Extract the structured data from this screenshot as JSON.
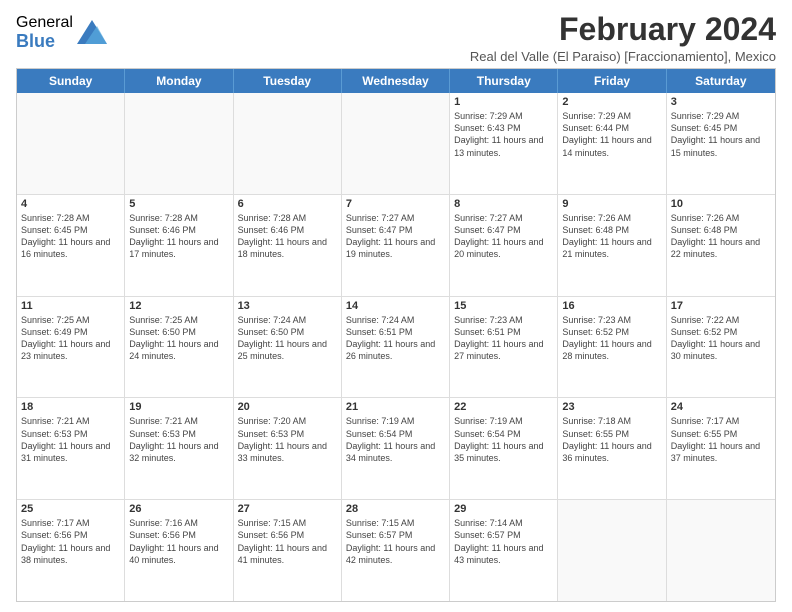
{
  "header": {
    "logo": {
      "general": "General",
      "blue": "Blue"
    },
    "title": "February 2024",
    "subtitle": "Real del Valle (El Paraiso) [Fraccionamiento], Mexico"
  },
  "calendar": {
    "days_of_week": [
      "Sunday",
      "Monday",
      "Tuesday",
      "Wednesday",
      "Thursday",
      "Friday",
      "Saturday"
    ],
    "weeks": [
      [
        {
          "day": "",
          "empty": true
        },
        {
          "day": "",
          "empty": true
        },
        {
          "day": "",
          "empty": true
        },
        {
          "day": "",
          "empty": true
        },
        {
          "day": "1",
          "sunrise": "7:29 AM",
          "sunset": "6:43 PM",
          "daylight": "11 hours and 13 minutes."
        },
        {
          "day": "2",
          "sunrise": "7:29 AM",
          "sunset": "6:44 PM",
          "daylight": "11 hours and 14 minutes."
        },
        {
          "day": "3",
          "sunrise": "7:29 AM",
          "sunset": "6:45 PM",
          "daylight": "11 hours and 15 minutes."
        }
      ],
      [
        {
          "day": "4",
          "sunrise": "7:28 AM",
          "sunset": "6:45 PM",
          "daylight": "11 hours and 16 minutes."
        },
        {
          "day": "5",
          "sunrise": "7:28 AM",
          "sunset": "6:46 PM",
          "daylight": "11 hours and 17 minutes."
        },
        {
          "day": "6",
          "sunrise": "7:28 AM",
          "sunset": "6:46 PM",
          "daylight": "11 hours and 18 minutes."
        },
        {
          "day": "7",
          "sunrise": "7:27 AM",
          "sunset": "6:47 PM",
          "daylight": "11 hours and 19 minutes."
        },
        {
          "day": "8",
          "sunrise": "7:27 AM",
          "sunset": "6:47 PM",
          "daylight": "11 hours and 20 minutes."
        },
        {
          "day": "9",
          "sunrise": "7:26 AM",
          "sunset": "6:48 PM",
          "daylight": "11 hours and 21 minutes."
        },
        {
          "day": "10",
          "sunrise": "7:26 AM",
          "sunset": "6:48 PM",
          "daylight": "11 hours and 22 minutes."
        }
      ],
      [
        {
          "day": "11",
          "sunrise": "7:25 AM",
          "sunset": "6:49 PM",
          "daylight": "11 hours and 23 minutes."
        },
        {
          "day": "12",
          "sunrise": "7:25 AM",
          "sunset": "6:50 PM",
          "daylight": "11 hours and 24 minutes."
        },
        {
          "day": "13",
          "sunrise": "7:24 AM",
          "sunset": "6:50 PM",
          "daylight": "11 hours and 25 minutes."
        },
        {
          "day": "14",
          "sunrise": "7:24 AM",
          "sunset": "6:51 PM",
          "daylight": "11 hours and 26 minutes."
        },
        {
          "day": "15",
          "sunrise": "7:23 AM",
          "sunset": "6:51 PM",
          "daylight": "11 hours and 27 minutes."
        },
        {
          "day": "16",
          "sunrise": "7:23 AM",
          "sunset": "6:52 PM",
          "daylight": "11 hours and 28 minutes."
        },
        {
          "day": "17",
          "sunrise": "7:22 AM",
          "sunset": "6:52 PM",
          "daylight": "11 hours and 30 minutes."
        }
      ],
      [
        {
          "day": "18",
          "sunrise": "7:21 AM",
          "sunset": "6:53 PM",
          "daylight": "11 hours and 31 minutes."
        },
        {
          "day": "19",
          "sunrise": "7:21 AM",
          "sunset": "6:53 PM",
          "daylight": "11 hours and 32 minutes."
        },
        {
          "day": "20",
          "sunrise": "7:20 AM",
          "sunset": "6:53 PM",
          "daylight": "11 hours and 33 minutes."
        },
        {
          "day": "21",
          "sunrise": "7:19 AM",
          "sunset": "6:54 PM",
          "daylight": "11 hours and 34 minutes."
        },
        {
          "day": "22",
          "sunrise": "7:19 AM",
          "sunset": "6:54 PM",
          "daylight": "11 hours and 35 minutes."
        },
        {
          "day": "23",
          "sunrise": "7:18 AM",
          "sunset": "6:55 PM",
          "daylight": "11 hours and 36 minutes."
        },
        {
          "day": "24",
          "sunrise": "7:17 AM",
          "sunset": "6:55 PM",
          "daylight": "11 hours and 37 minutes."
        }
      ],
      [
        {
          "day": "25",
          "sunrise": "7:17 AM",
          "sunset": "6:56 PM",
          "daylight": "11 hours and 38 minutes."
        },
        {
          "day": "26",
          "sunrise": "7:16 AM",
          "sunset": "6:56 PM",
          "daylight": "11 hours and 40 minutes."
        },
        {
          "day": "27",
          "sunrise": "7:15 AM",
          "sunset": "6:56 PM",
          "daylight": "11 hours and 41 minutes."
        },
        {
          "day": "28",
          "sunrise": "7:15 AM",
          "sunset": "6:57 PM",
          "daylight": "11 hours and 42 minutes."
        },
        {
          "day": "29",
          "sunrise": "7:14 AM",
          "sunset": "6:57 PM",
          "daylight": "11 hours and 43 minutes."
        },
        {
          "day": "",
          "empty": true
        },
        {
          "day": "",
          "empty": true
        }
      ]
    ]
  }
}
